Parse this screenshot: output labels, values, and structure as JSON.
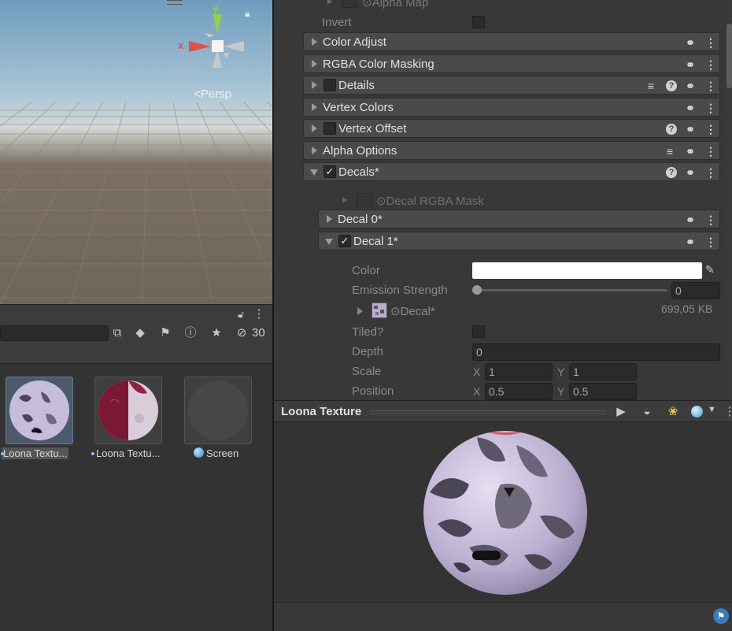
{
  "scene": {
    "gizmo": {
      "y": "y",
      "x": "x"
    },
    "persp_label": "<Persp"
  },
  "project": {
    "hidden_count": "30",
    "assets": [
      {
        "label": "Loona Textu..."
      },
      {
        "label": "Loona Textu..."
      },
      {
        "label": "Screen"
      }
    ]
  },
  "inspector": {
    "alpha_map_label": "Alpha Map",
    "invert_label": "Invert",
    "sections": [
      {
        "label": "Color Adjust"
      },
      {
        "label": "RGBA Color Masking"
      },
      {
        "label": "Details"
      },
      {
        "label": "Vertex Colors"
      },
      {
        "label": "Vertex Offset"
      },
      {
        "label": "Alpha Options"
      },
      {
        "label": "Decals*"
      }
    ],
    "decal_rgba_mask": "Decal RGBA Mask",
    "decal0": "Decal 0*",
    "decal1": "Decal 1*",
    "props": {
      "color_label": "Color",
      "emission_label": "Emission Strength",
      "emission_value": "0",
      "decal_tex_label": "Decal*",
      "decal_tex_size": "699,05 KB",
      "tiled_label": "Tiled?",
      "depth_label": "Depth",
      "depth_value": "0",
      "scale_label": "Scale",
      "scale_x": "1",
      "scale_y": "1",
      "position_label": "Position",
      "position_x": "0.5",
      "position_y": "0.5",
      "x_label": "X",
      "y_label": "Y"
    }
  },
  "preview": {
    "title": "Loona Texture"
  },
  "colors": {
    "panel": "#383838",
    "header": "#4a4a4a",
    "accent_blue": "#3a79bb"
  }
}
